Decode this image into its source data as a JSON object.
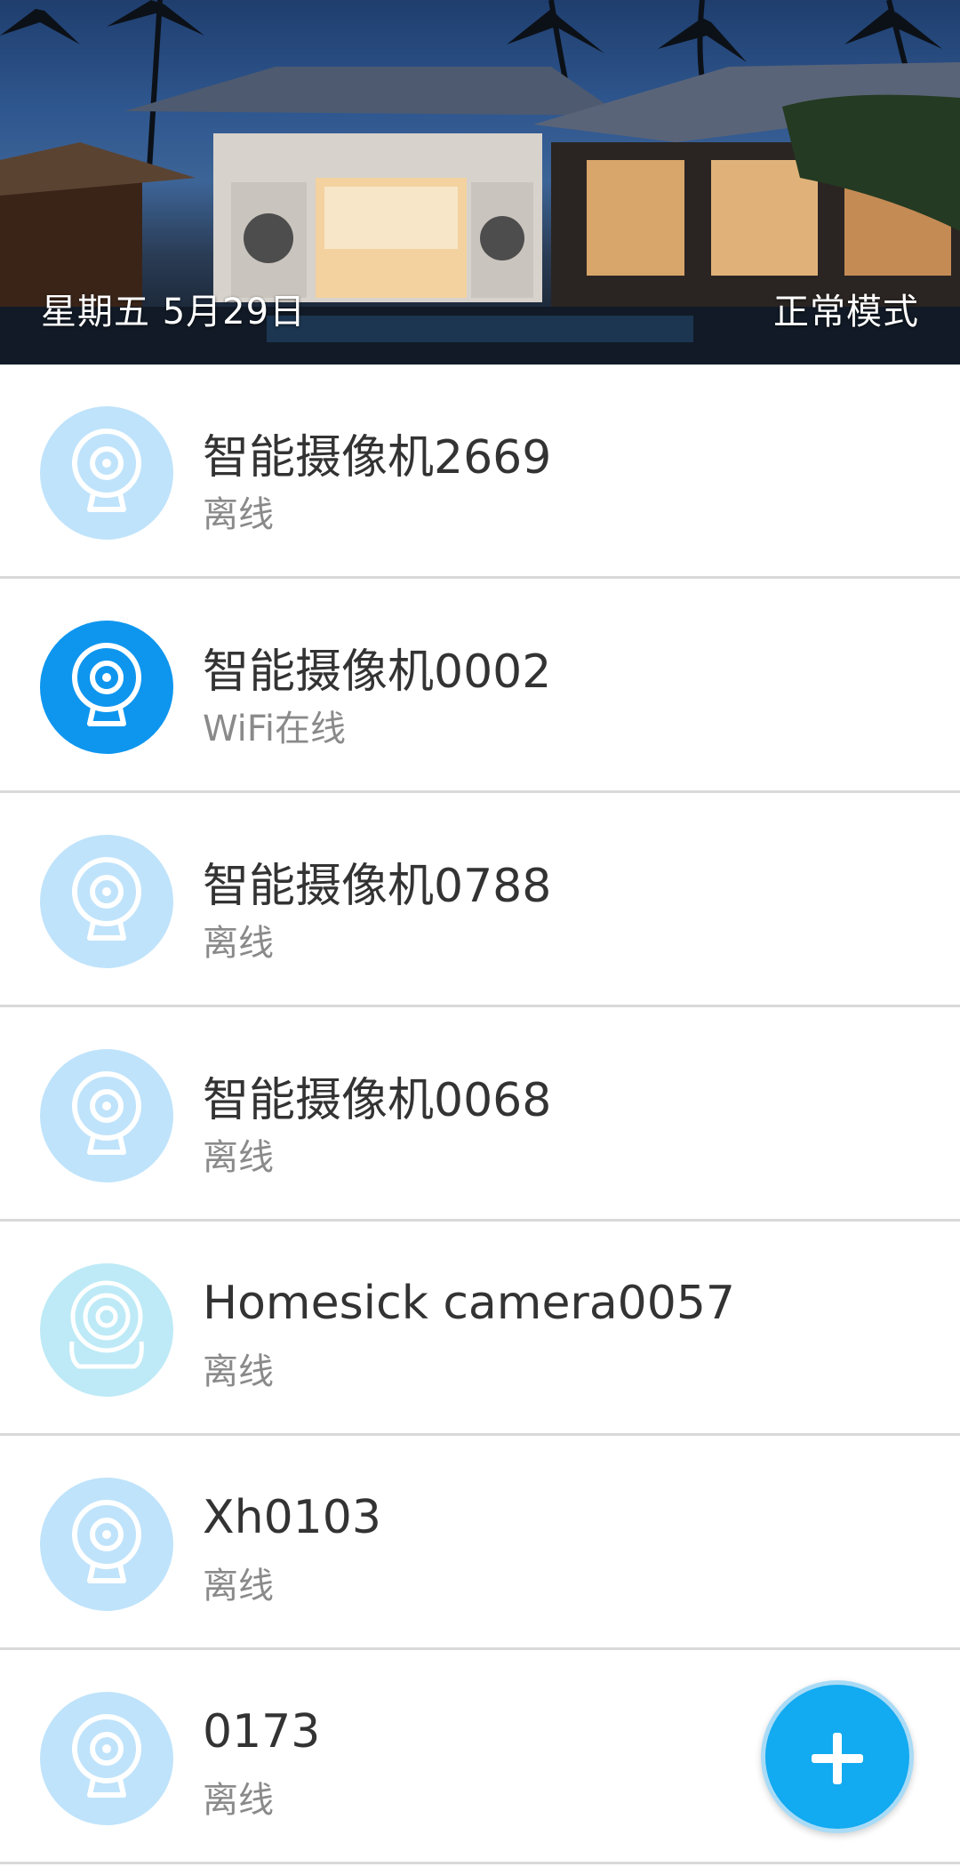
{
  "header": {
    "date": "星期五 5月29日",
    "mode": "正常模式"
  },
  "devices": [
    {
      "name": "智能摄像机2669",
      "status": "离线",
      "online": false,
      "icon": "webcam-icon"
    },
    {
      "name": "智能摄像机0002",
      "status": "WiFi在线",
      "online": true,
      "icon": "webcam-icon"
    },
    {
      "name": "智能摄像机0788",
      "status": "离线",
      "online": false,
      "icon": "webcam-icon"
    },
    {
      "name": "智能摄像机0068",
      "status": "离线",
      "online": false,
      "icon": "webcam-icon"
    },
    {
      "name": "Homesick camera0057",
      "status": "离线",
      "online": false,
      "icon": "dome-camera-icon"
    },
    {
      "name": "Xh0103",
      "status": "离线",
      "online": false,
      "icon": "webcam-icon"
    },
    {
      "name": "0173",
      "status": "离线",
      "online": false,
      "icon": "webcam-icon"
    }
  ],
  "fab": {
    "icon": "plus-icon"
  },
  "colors": {
    "accent": "#0e96ef",
    "offline_avatar": "#bfe3fb",
    "fab": "#12aaf0"
  }
}
